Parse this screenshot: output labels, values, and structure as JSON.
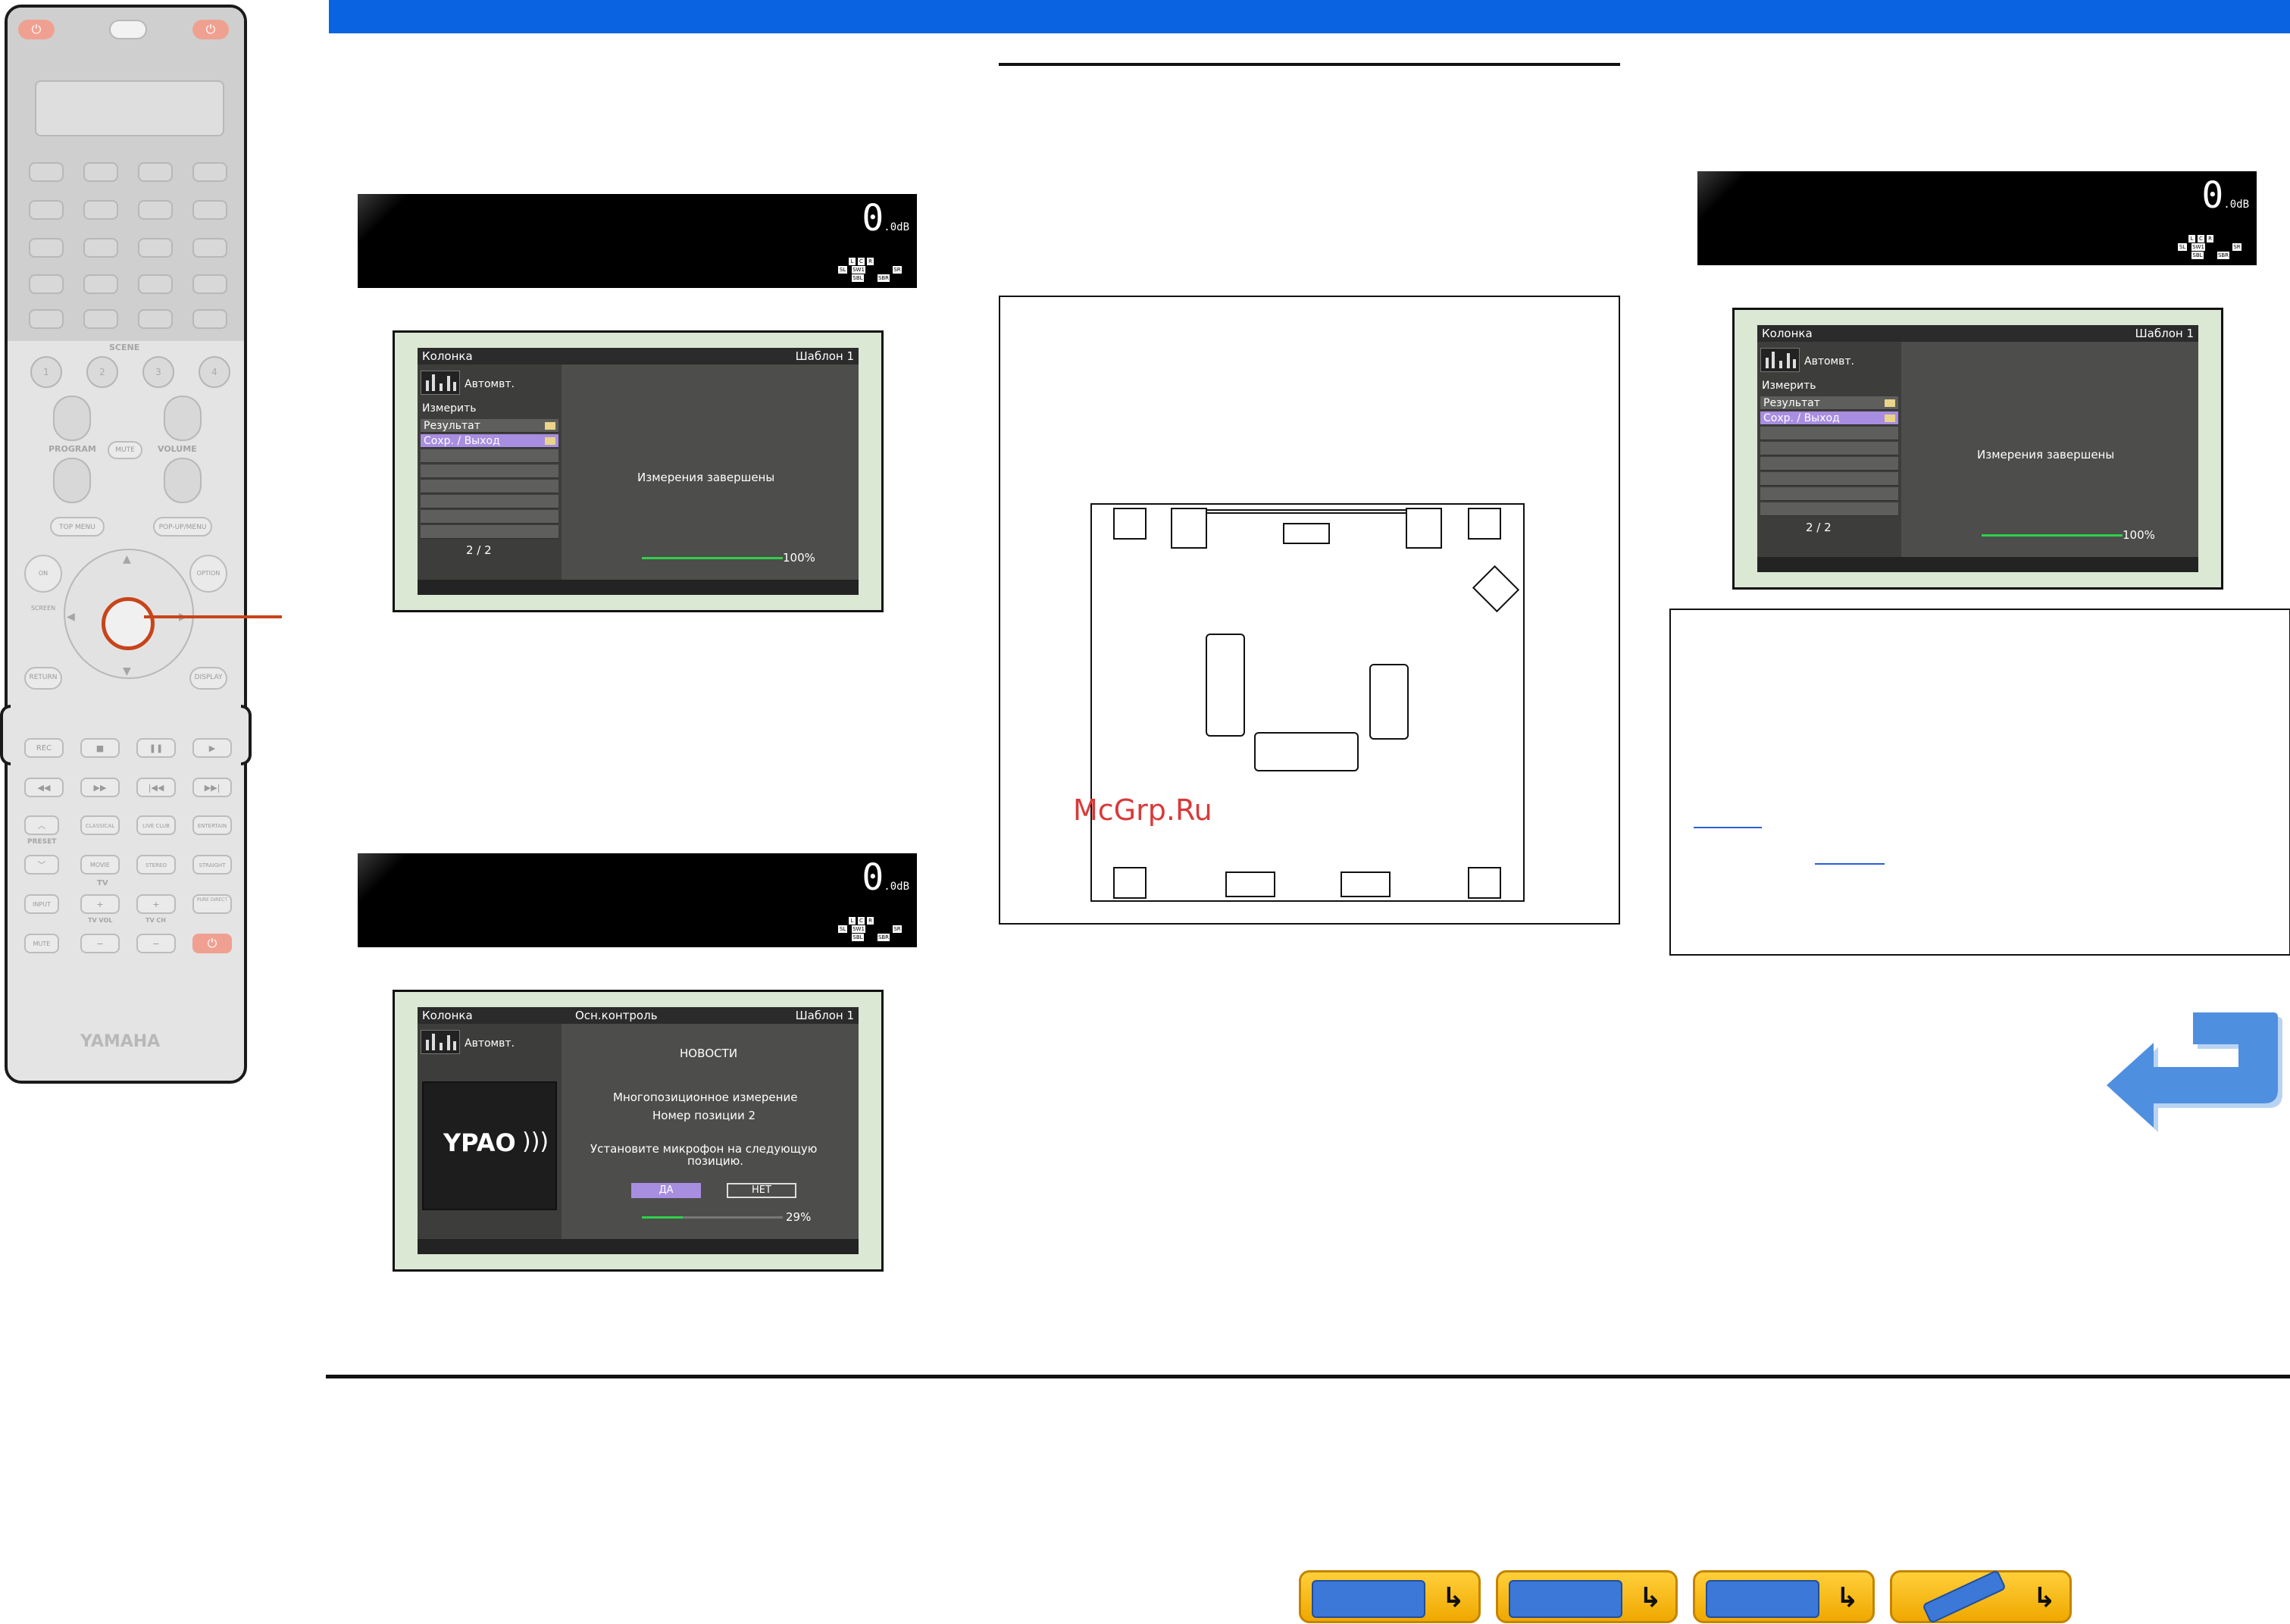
{
  "remote": {
    "scene_label": "SCENE",
    "scene_keys": [
      "1",
      "2",
      "3",
      "4"
    ],
    "program_label": "PROGRAM",
    "volume_label": "VOLUME",
    "mute_center": "MUTE",
    "top_menu": "TOP MENU",
    "popup_menu": "POP-UP/MENU",
    "on_screen": "ON SCREEN",
    "option": "OPTION",
    "return": "RETURN",
    "display": "DISPLAY",
    "rec": "REC",
    "preset": "PRESET",
    "tv_label": "TV",
    "mode_keys": [
      "CLASSICAL",
      "LIVE CLUB",
      "ENTERTAIN",
      "MOVIE",
      "STEREO",
      "STRAIGHT"
    ],
    "input": "INPUT",
    "tv_vol": "TV VOL",
    "tv_ch": "TV CH",
    "pure_direct": "PURE DIRECT",
    "mute": "MUTE",
    "brand": "YAMAHA"
  },
  "front_panel": {
    "value": "0",
    "sub": ".0",
    "unit": "dB",
    "speakers": [
      "L",
      "C",
      "R",
      "SL",
      "SW1",
      "SR",
      "SBL",
      "SBR"
    ]
  },
  "osd1": {
    "header_left": "Колонка",
    "header_right": "Шаблон 1",
    "auto_label": "Автомвт.",
    "measure_label": "Измерить",
    "rows": [
      "Результат",
      "Сохр. / Выход"
    ],
    "page": "2 / 2",
    "message": "Измерения завершены",
    "percent": "100%",
    "progress": 1.0
  },
  "osd2": {
    "header_left": "Колонка",
    "header_mid": "Осн.контроль",
    "header_right": "Шаблон 1",
    "auto_label": "Автомвт.",
    "logo": "YPAO",
    "news": "НОВОСТИ",
    "line1": "Многопозиционное измерение",
    "line2": "Номер позиции 2",
    "line3": "Установите микрофон на следующую",
    "line4": "позицию.",
    "yes": "ДА",
    "no": "НЕТ",
    "percent": "29%",
    "progress": 0.29
  },
  "osd3": {
    "header_left": "Колонка",
    "header_right": "Шаблон 1",
    "auto_label": "Автомвт.",
    "measure_label": "Измерить",
    "rows": [
      "Результат",
      "Сохр. / Выход"
    ],
    "page": "2 / 2",
    "message": "Измерения завершены",
    "percent": "100%",
    "progress": 1.0
  },
  "watermark": "McGrp.Ru",
  "colors": {
    "top_bar": "#0a63e0",
    "osd_bg": "#4d4d4b",
    "selection": "#a88ee0",
    "progress": "#2fd14a",
    "nav_button": "#ffcf3a",
    "link": "#2a5fd6"
  },
  "nav_icons": [
    "receiver-icon",
    "front-panel-icon",
    "rear-panel-icon",
    "remote-icon"
  ]
}
